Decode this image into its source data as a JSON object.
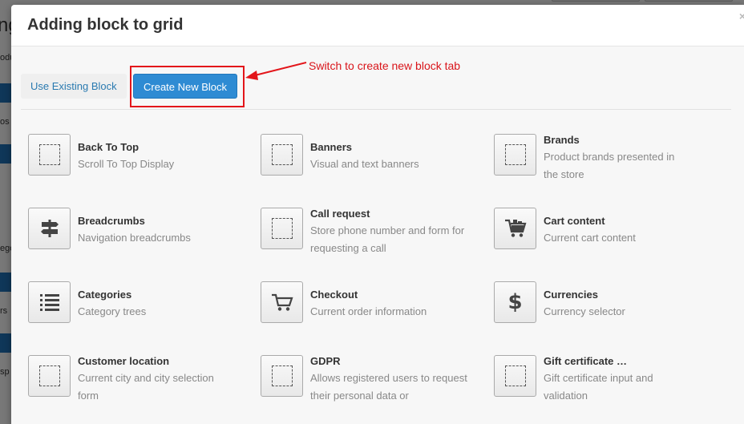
{
  "background": {
    "fragments": [
      "ng",
      "odu",
      "os",
      "ego",
      "rs",
      "sp"
    ]
  },
  "modal": {
    "title": "Adding block to grid",
    "close_symbol": "×",
    "tabs": {
      "existing": "Use Existing Block",
      "new": "Create New Block"
    },
    "annotation": "Switch to create new block tab",
    "blocks": [
      {
        "title": "Back To Top",
        "desc": "Scroll To Top Display",
        "icon": "dotted-square-icon"
      },
      {
        "title": "Banners",
        "desc": "Visual and text banners",
        "icon": "dotted-square-icon"
      },
      {
        "title": "Brands",
        "desc": "Product brands presented in the store",
        "icon": "dotted-square-icon"
      },
      {
        "title": "Breadcrumbs",
        "desc": "Navigation breadcrumbs",
        "icon": "signpost-icon"
      },
      {
        "title": "Call request",
        "desc": "Store phone number and form for requesting a call",
        "icon": "dotted-square-icon"
      },
      {
        "title": "Cart content",
        "desc": "Current cart content",
        "icon": "cart-full-icon"
      },
      {
        "title": "Categories",
        "desc": "Category trees",
        "icon": "list-icon"
      },
      {
        "title": "Checkout",
        "desc": "Current order information",
        "icon": "cart-icon"
      },
      {
        "title": "Currencies",
        "desc": "Currency selector",
        "icon": "dollar-icon"
      },
      {
        "title": "Customer location",
        "desc": "Current city and city selection form",
        "icon": "dotted-square-icon"
      },
      {
        "title": "GDPR",
        "desc": "Allows registered users to request their personal data or",
        "icon": "dotted-square-icon"
      },
      {
        "title": "Gift certificate …",
        "desc": "Gift certificate input and validation",
        "icon": "dotted-square-icon"
      }
    ]
  }
}
